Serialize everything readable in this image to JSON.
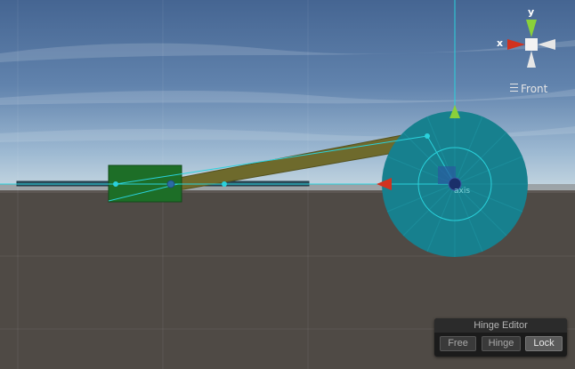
{
  "scene": {
    "sky_top": "#4a6b99",
    "sky_bottom": "#aac7dc",
    "ground": "#4f4a45",
    "wheel_color": "#17808e",
    "block_color": "#1d6e27",
    "rod_color": "#6e6a2c",
    "handle_color": "#2ad1db",
    "axis_label": "axis"
  },
  "gizmo": {
    "y_label": "y",
    "x_label": "x",
    "view_label": "Front"
  },
  "hinge_editor": {
    "title": "Hinge Editor",
    "buttons": [
      {
        "label": "Free",
        "selected": false
      },
      {
        "label": "Hinge",
        "selected": false
      },
      {
        "label": "Lock",
        "selected": true
      }
    ]
  }
}
